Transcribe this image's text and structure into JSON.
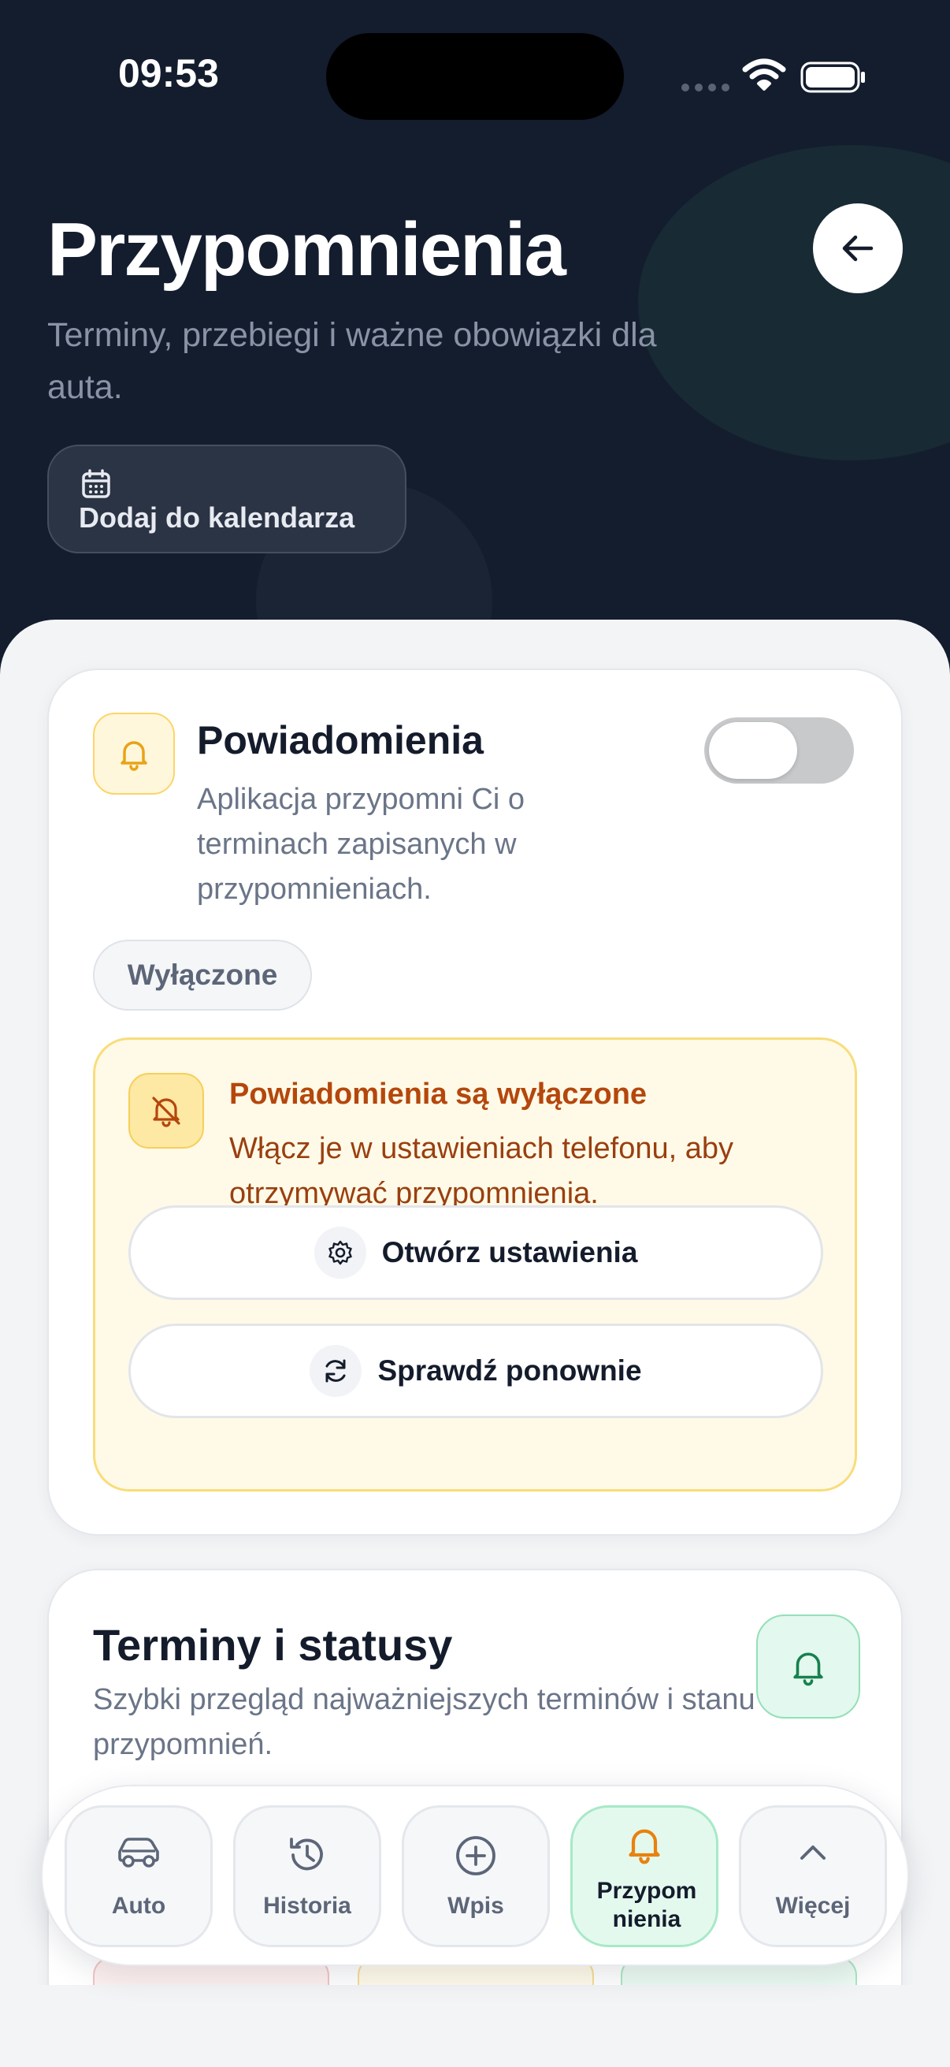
{
  "status_bar": {
    "time": "09:53"
  },
  "header": {
    "title": "Przypomnienia",
    "subtitle": "Terminy, przebiegi i ważne obowiązki dla auta.",
    "calendar_button_label": "Dodaj do kalendarza"
  },
  "notifications_card": {
    "title": "Powiadomienia",
    "description": "Aplikacja przypomni Ci o terminach zapisanych w przypomnieniach.",
    "toggle_on": false,
    "status_label": "Wyłączone",
    "warning": {
      "title": "Powiadomienia są wyłączone",
      "description": "Włącz je w ustawieniach telefonu, aby otrzymywać przypomnienia.",
      "open_settings_label": "Otwórz ustawienia",
      "recheck_label": "Sprawdź ponownie"
    }
  },
  "terms_card": {
    "title": "Terminy i statusy",
    "description": "Szybki przegląd najważniejszych terminów i stanu przypomnień."
  },
  "tab_bar": {
    "tabs": [
      {
        "label": "Auto",
        "icon": "car-icon"
      },
      {
        "label": "Historia",
        "icon": "history-icon"
      },
      {
        "label": "Wpis",
        "icon": "plus-circle-icon"
      },
      {
        "label": "Przypomnienia",
        "icon": "bell-icon",
        "active": true
      },
      {
        "label": "Więcej",
        "icon": "chevron-up-icon"
      }
    ]
  },
  "colors": {
    "header_bg": "#141d2e",
    "accent_warning": "#b5470c",
    "accent_active": "#e4f9ee",
    "accent_bell": "#e8a317"
  }
}
